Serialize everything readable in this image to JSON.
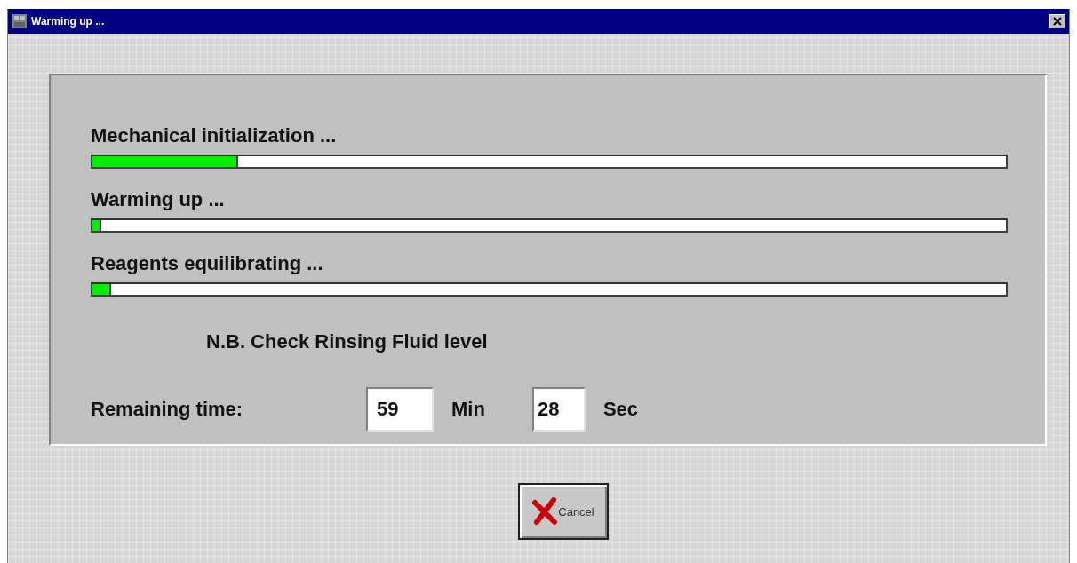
{
  "window": {
    "title": "Warming up ..."
  },
  "progress": [
    {
      "label": "Mechanical initialization ...",
      "level": 0.16
    },
    {
      "label": "Warming up ...",
      "level": 0.01
    },
    {
      "label": "Reagents equilibrating ...",
      "level": 0.02
    }
  ],
  "note": "N.B. Check Rinsing Fluid level",
  "remaining_time": {
    "label": "Remaining time:",
    "minutes": "59",
    "minutes_unit": "Min",
    "seconds": "28",
    "seconds_unit": "Sec"
  },
  "buttons": [
    {
      "label": "Cancel"
    }
  ]
}
